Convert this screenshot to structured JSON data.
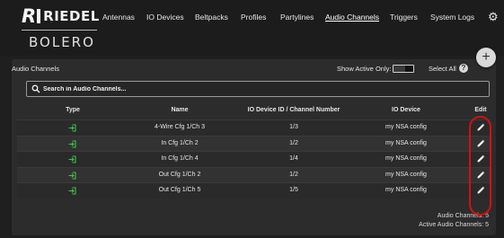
{
  "brand": {
    "name": "RIEDEL",
    "product": "BOLERO"
  },
  "nav": {
    "items": [
      {
        "label": "Antennas"
      },
      {
        "label": "IO Devices"
      },
      {
        "label": "Beltpacks"
      },
      {
        "label": "Profiles"
      },
      {
        "label": "Partylines"
      },
      {
        "label": "Audio Channels",
        "active": true
      },
      {
        "label": "Triggers"
      },
      {
        "label": "System Logs"
      }
    ],
    "settings_icon": "gear-icon"
  },
  "panel": {
    "title": "Audio Channels",
    "show_active_label": "Show Active Only:",
    "show_active_on": false,
    "select_all_label": "Select All",
    "help_label": "?",
    "add_label": "+"
  },
  "search": {
    "placeholder": "Search in Audio Channels..."
  },
  "table": {
    "headers": {
      "type": "Type",
      "name": "Name",
      "device_channel": "IO Device ID / Channel Number",
      "device": "IO Device",
      "edit": "Edit"
    },
    "rows": [
      {
        "name": "4-Wire Cfg 1/Ch 3",
        "device_channel": "1/3",
        "device": "my NSA config"
      },
      {
        "name": "In Cfg 1/Ch 2",
        "device_channel": "1/2",
        "device": "my NSA config"
      },
      {
        "name": "In Cfg 1/Ch 4",
        "device_channel": "1/4",
        "device": "my NSA config"
      },
      {
        "name": "Out Cfg 1/Ch 2",
        "device_channel": "1/2",
        "device": "my NSA config"
      },
      {
        "name": "Out Cfg 1/Ch 5",
        "device_channel": "1/5",
        "device": "my NSA config"
      }
    ]
  },
  "footer": {
    "audio_channels": "Audio Channels: 5",
    "active_audio_channels": "Active Audio Channels: 5"
  },
  "colors": {
    "type_icon": "#3fbf4a",
    "highlight": "#d41010",
    "background": "#1f1f1f",
    "panel": "#2c2c2c"
  }
}
